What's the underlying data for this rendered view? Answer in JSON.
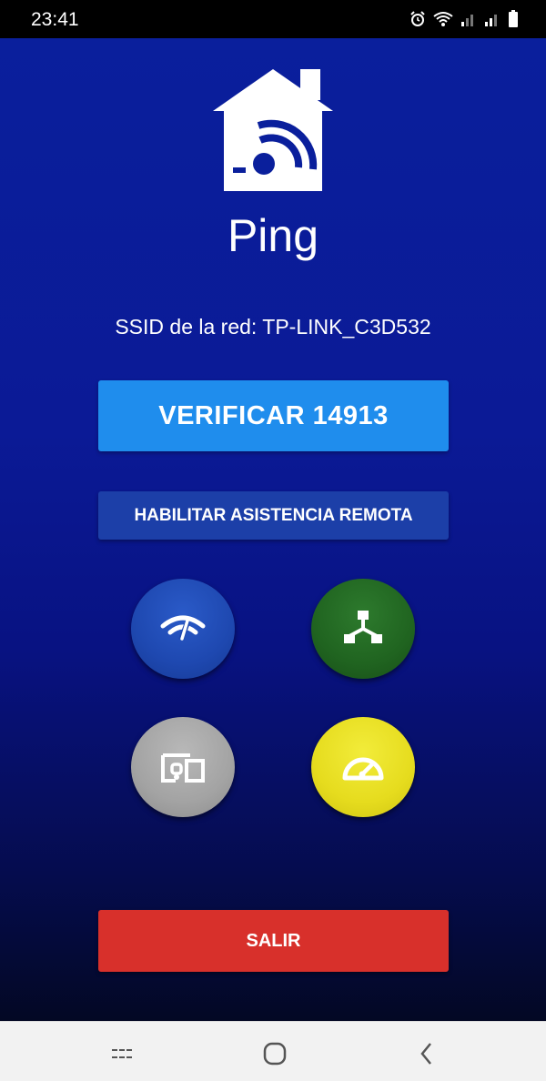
{
  "status_bar": {
    "time": "23:41",
    "icons": [
      "alarm-icon",
      "wifi-icon",
      "signal-icon",
      "signal-icon-2",
      "battery-icon"
    ]
  },
  "app": {
    "title": "Ping",
    "ssid_label": "SSID de la red:",
    "ssid_value": "TP-LINK_C3D532",
    "verify_label": "VERIFICAR 14913",
    "remote_label": "HABILITAR ASISTENCIA REMOTA",
    "exit_label": "SALIR",
    "actions": [
      {
        "icon": "wifi-speed-icon",
        "color": "#1e48b0"
      },
      {
        "icon": "network-topology-icon",
        "color": "#206420"
      },
      {
        "icon": "devices-icon",
        "color": "#a3a3a3"
      },
      {
        "icon": "speedometer-icon",
        "color": "#e6dc1e"
      }
    ]
  },
  "nav_bar": {
    "buttons": [
      "recents-icon",
      "home-icon",
      "back-icon"
    ]
  },
  "colors": {
    "background": "#0a1f9c",
    "verify_button": "#1f8ded",
    "remote_button": "#1c3fa8",
    "exit_button": "#d8302b"
  }
}
